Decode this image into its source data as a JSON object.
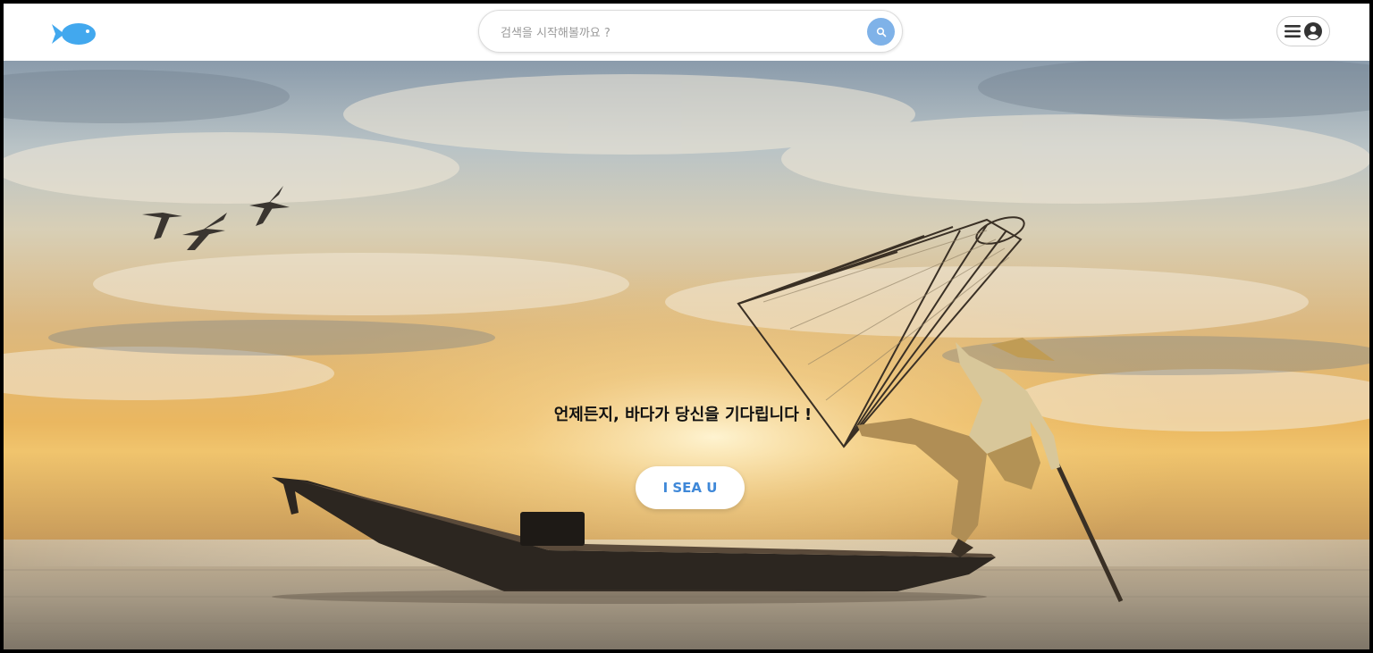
{
  "header": {
    "logo_icon": "fish-icon",
    "search": {
      "placeholder": "검색을 시작해볼까요 ?",
      "value": "",
      "button_icon": "search-icon"
    },
    "menu": {
      "icons": [
        "hamburger-menu-icon",
        "user-account-icon"
      ]
    }
  },
  "hero": {
    "background": "sunset sea fisherman photo",
    "tagline": "언제든지, 바다가 당신을 기다립니다 !",
    "cta_label": "I SEA U"
  },
  "colors": {
    "brand_blue": "#3f88d8",
    "search_button": "#7fb2e8",
    "logo_blue": "#42a8ee"
  }
}
